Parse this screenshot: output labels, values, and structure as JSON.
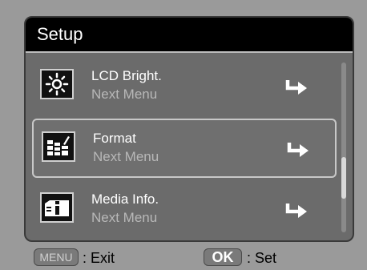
{
  "header": {
    "title": "Setup"
  },
  "menu": {
    "items": [
      {
        "label": "LCD Bright.",
        "sub": "Next Menu",
        "icon": "brightness-icon"
      },
      {
        "label": "Format",
        "sub": "Next Menu",
        "icon": "format-icon"
      },
      {
        "label": "Media Info.",
        "sub": "Next Menu",
        "icon": "media-info-icon"
      }
    ],
    "selected_index": 1
  },
  "footer": {
    "menu_key": "MENU",
    "menu_action": ": Exit",
    "ok_key": "OK",
    "ok_action": ": Set"
  }
}
